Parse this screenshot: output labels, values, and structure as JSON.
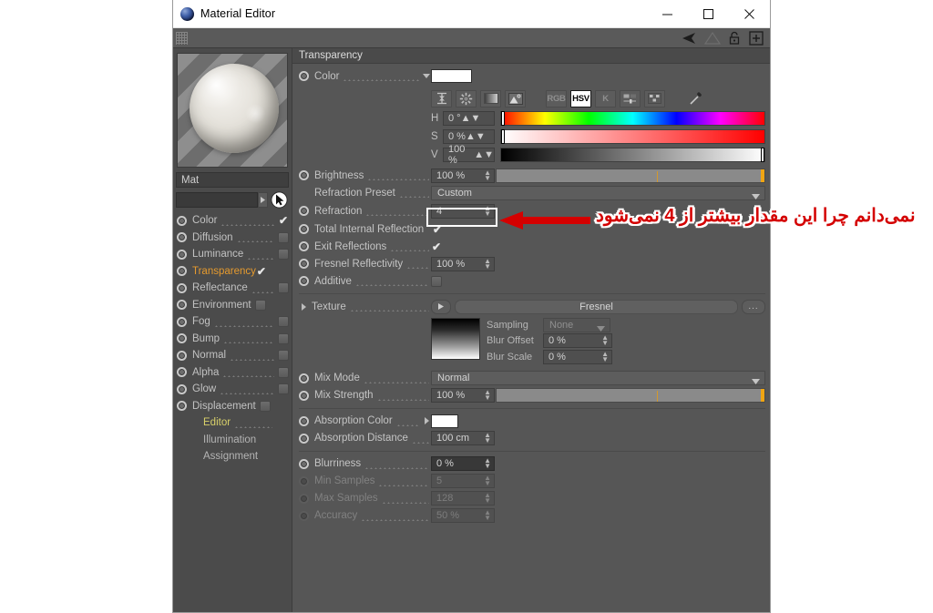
{
  "window": {
    "title": "Material Editor",
    "app_icon": "material-sphere-icon",
    "minimize_label": "—",
    "maximize_label": "□",
    "close_label": "✕"
  },
  "toolbar": {
    "grip": "drag-grip",
    "icons": [
      "solid-arrow-icon",
      "outline-arrow-icon",
      "lock-icon",
      "plus-icon"
    ]
  },
  "left_panel": {
    "preview_label": "material-preview",
    "material_name": "Mat",
    "search_value": "",
    "search_placeholder": "",
    "cursor_icon": "arrow-cursor-icon",
    "channels": [
      {
        "label": "Color",
        "enabled": true,
        "checked": true,
        "state": "on"
      },
      {
        "label": "Diffusion",
        "enabled": true,
        "checked": false,
        "state": "on"
      },
      {
        "label": "Luminance",
        "enabled": true,
        "checked": false,
        "state": "on"
      },
      {
        "label": "Transparency",
        "enabled": true,
        "checked": true,
        "state": "active"
      },
      {
        "label": "Reflectance",
        "enabled": true,
        "checked": false,
        "state": "on"
      },
      {
        "label": "Environment",
        "enabled": true,
        "checked": false,
        "state": "on"
      },
      {
        "label": "Fog",
        "enabled": true,
        "checked": false,
        "state": "on"
      },
      {
        "label": "Bump",
        "enabled": true,
        "checked": false,
        "state": "on"
      },
      {
        "label": "Normal",
        "enabled": true,
        "checked": false,
        "state": "on"
      },
      {
        "label": "Alpha",
        "enabled": true,
        "checked": false,
        "state": "on"
      },
      {
        "label": "Glow",
        "enabled": true,
        "checked": false,
        "state": "on"
      },
      {
        "label": "Displacement",
        "enabled": true,
        "checked": false,
        "state": "on"
      }
    ],
    "sub_items": [
      {
        "label": "Editor",
        "state": "selected"
      },
      {
        "label": "Illumination",
        "state": "normal"
      },
      {
        "label": "Assignment",
        "state": "normal"
      }
    ]
  },
  "panel": {
    "header": "Transparency",
    "color": {
      "label": "Color",
      "swatch": "#ffffff",
      "mode_buttons": [
        {
          "name": "range-icon",
          "label": ""
        },
        {
          "name": "colorwheel-icon",
          "label": ""
        },
        {
          "name": "gradient-icon",
          "label": ""
        },
        {
          "name": "picture-icon",
          "label": ""
        },
        {
          "name": "rgb-mode",
          "label": "RGB",
          "active": false
        },
        {
          "name": "hsv-mode",
          "label": "HSV",
          "active": true
        },
        {
          "name": "kelvin-mode",
          "label": "K",
          "active": false
        },
        {
          "name": "mixer-icon",
          "label": ""
        },
        {
          "name": "swatches-icon",
          "label": ""
        },
        {
          "name": "eyedropper-icon",
          "label": ""
        }
      ],
      "channels": [
        {
          "key": "H",
          "value": "0 °",
          "pos": 0
        },
        {
          "key": "S",
          "value": "0 %",
          "pos": 0
        },
        {
          "key": "V",
          "value": "100 %",
          "pos": 100
        }
      ]
    },
    "brightness": {
      "label": "Brightness",
      "value": "100 %",
      "slider_pct": 100,
      "tick_pct": 60
    },
    "refraction_preset": {
      "label": "Refraction Preset",
      "value": "Custom"
    },
    "refraction": {
      "label": "Refraction",
      "value": "4",
      "highlighted": true
    },
    "total_internal_reflection": {
      "label": "Total Internal Reflection",
      "checked": true
    },
    "exit_reflections": {
      "label": "Exit Reflections",
      "checked": true
    },
    "fresnel_reflectivity": {
      "label": "Fresnel Reflectivity",
      "value": "100 %"
    },
    "additive": {
      "label": "Additive",
      "checked": false
    },
    "texture": {
      "label": "Texture",
      "value": "Fresnel",
      "browse_label": "...",
      "sampling": {
        "label": "Sampling",
        "value": "None"
      },
      "blur_offset": {
        "label": "Blur Offset",
        "value": "0 %"
      },
      "blur_scale": {
        "label": "Blur Scale",
        "value": "0 %"
      }
    },
    "mix_mode": {
      "label": "Mix Mode",
      "value": "Normal"
    },
    "mix_strength": {
      "label": "Mix Strength",
      "value": "100 %",
      "slider_pct": 100,
      "tick_pct": 60
    },
    "absorption_color": {
      "label": "Absorption Color",
      "swatch": "#ffffff"
    },
    "absorption_distance": {
      "label": "Absorption Distance",
      "value": "100 cm"
    },
    "blurriness": {
      "label": "Blurriness",
      "value": "0 %",
      "disabled": false
    },
    "min_samples": {
      "label": "Min Samples",
      "value": "5",
      "disabled": true
    },
    "max_samples": {
      "label": "Max Samples",
      "value": "128",
      "disabled": true
    },
    "accuracy": {
      "label": "Accuracy",
      "value": "50 %",
      "disabled": true
    }
  },
  "annotation": {
    "text": "نمی‌دانم چرا این مقدار بیشتر از 4 نمی‌شود",
    "color": "#d40000",
    "arrow": "left-arrow-icon",
    "highlight_box": "refraction-highlight"
  }
}
